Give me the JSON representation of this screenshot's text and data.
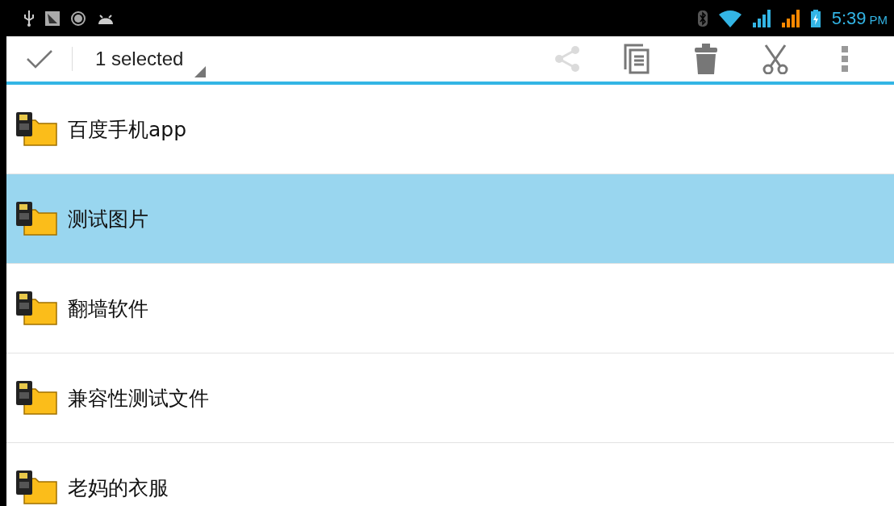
{
  "status_bar": {
    "time": "5:39",
    "meridiem": "PM"
  },
  "action_bar": {
    "title": "1 selected",
    "actions": [
      {
        "kind": "share",
        "disabled": true
      },
      {
        "kind": "copy",
        "disabled": false
      },
      {
        "kind": "delete",
        "disabled": false
      },
      {
        "kind": "cut",
        "disabled": false
      },
      {
        "kind": "more",
        "disabled": false
      }
    ]
  },
  "folders": [
    {
      "name": "百度手机app",
      "selected": false
    },
    {
      "name": "测试图片",
      "selected": true
    },
    {
      "name": "翻墙软件",
      "selected": false
    },
    {
      "name": "兼容性测试文件",
      "selected": false
    },
    {
      "name": "老妈的衣服",
      "selected": false
    }
  ]
}
